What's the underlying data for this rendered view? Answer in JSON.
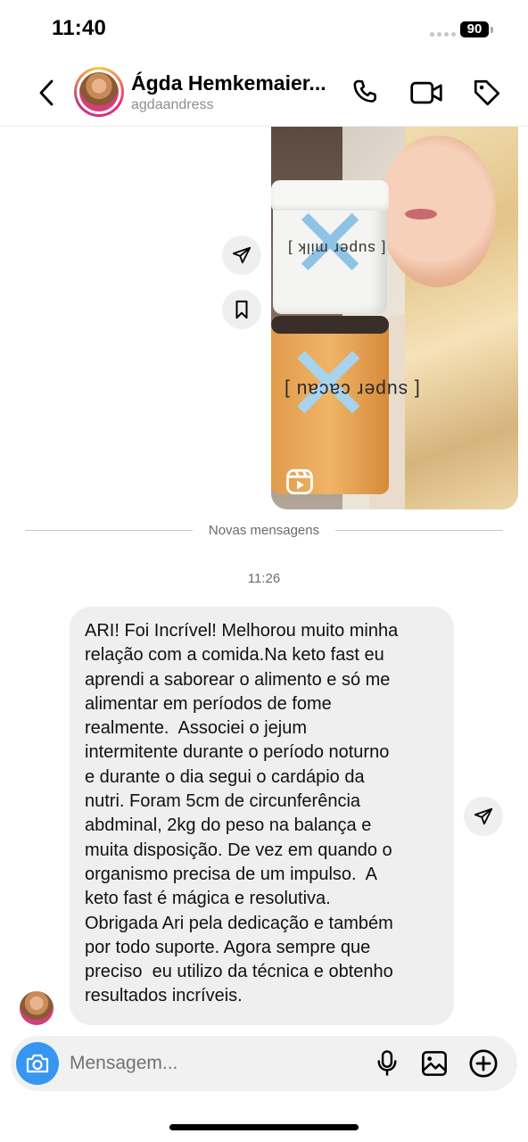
{
  "status_bar": {
    "time": "11:40",
    "battery": "90"
  },
  "header": {
    "name": "Ágda Hemkemaier...",
    "username": "agdaandress",
    "icons": [
      "back-icon",
      "phone-icon",
      "video-icon",
      "tag-icon"
    ]
  },
  "shared_media": {
    "jar_top_label": "[ super milk ]",
    "jar_bottom_label": "[ super cacau ]",
    "badge_icon": "reels-icon"
  },
  "media_actions": [
    "share-icon",
    "bookmark-icon"
  ],
  "divider": {
    "label": "Novas mensagens"
  },
  "timestamp": "11:26",
  "message": {
    "lines": [
      "ARI! Foi Incrível! Melhorou muito minha",
      "relação com a comida.Na keto fast eu",
      "aprendi a saborear o alimento e só me",
      "alimentar em períodos de fome",
      "realmente.  Associei o jejum",
      "intermitente durante o período noturno",
      "e durante o dia segui o cardápio da",
      "nutri. Foram 5cm de circunferência",
      "abdminal, 2kg do peso na balança e",
      "muita disposição. De vez em quando o",
      "organismo precisa de um impulso.  A",
      "keto fast é mágica e resolutiva.",
      "Obrigada Ari pela dedicação e também",
      "por todo suporte. Agora sempre que",
      "preciso  eu utilizo da técnica e obtenho",
      "resultados incríveis."
    ]
  },
  "composer": {
    "placeholder": "Mensagem...",
    "icons": [
      "camera-icon",
      "microphone-icon",
      "gallery-icon",
      "plus-icon"
    ]
  },
  "colors": {
    "accent": "#3797f0",
    "bubble": "#efefef",
    "muted": "#8e8e8e"
  }
}
